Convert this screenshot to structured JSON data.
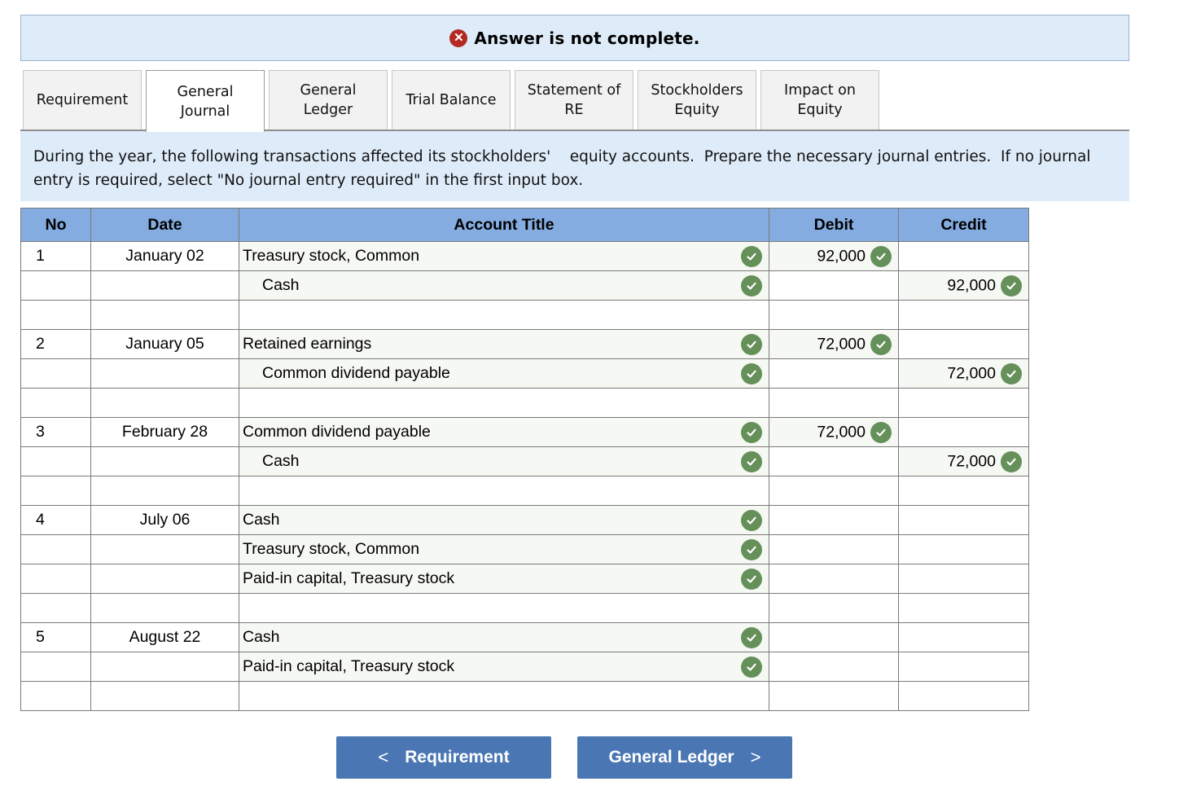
{
  "banner": {
    "icon": "error-x-icon",
    "text": "Answer is not complete."
  },
  "tabs": [
    {
      "label": "Requirement",
      "active": false
    },
    {
      "label": "General\nJournal",
      "active": true
    },
    {
      "label": "General\nLedger",
      "active": false
    },
    {
      "label": "Trial Balance",
      "active": false
    },
    {
      "label": "Statement of\nRE",
      "active": false
    },
    {
      "label": "Stockholders\nEquity",
      "active": false
    },
    {
      "label": "Impact on\nEquity",
      "active": false
    }
  ],
  "instructions": "During the year, the following transactions affected its stockholders'    equity accounts.  Prepare the necessary journal entries.  If no journal entry is required, select \"No journal entry required\" in the first input box.",
  "journal": {
    "headers": {
      "no": "No",
      "date": "Date",
      "account": "Account Title",
      "debit": "Debit",
      "credit": "Credit"
    },
    "rows": [
      {
        "no": "1",
        "date": "January 02",
        "account": "Treasury stock, Common",
        "indent": false,
        "acct_check": true,
        "debit": "92,000",
        "debit_check": true,
        "credit": "",
        "credit_check": false
      },
      {
        "no": "",
        "date": "",
        "account": "Cash",
        "indent": true,
        "acct_check": true,
        "debit": "",
        "debit_check": false,
        "credit": "92,000",
        "credit_check": true
      },
      {
        "no": "",
        "date": "",
        "account": "",
        "indent": false,
        "acct_check": false,
        "debit": "",
        "debit_check": false,
        "credit": "",
        "credit_check": false
      },
      {
        "no": "2",
        "date": "January 05",
        "account": "Retained earnings",
        "indent": false,
        "acct_check": true,
        "debit": "72,000",
        "debit_check": true,
        "credit": "",
        "credit_check": false
      },
      {
        "no": "",
        "date": "",
        "account": "Common dividend payable",
        "indent": true,
        "acct_check": true,
        "debit": "",
        "debit_check": false,
        "credit": "72,000",
        "credit_check": true
      },
      {
        "no": "",
        "date": "",
        "account": "",
        "indent": false,
        "acct_check": false,
        "debit": "",
        "debit_check": false,
        "credit": "",
        "credit_check": false
      },
      {
        "no": "3",
        "date": "February 28",
        "account": "Common dividend payable",
        "indent": false,
        "acct_check": true,
        "debit": "72,000",
        "debit_check": true,
        "credit": "",
        "credit_check": false
      },
      {
        "no": "",
        "date": "",
        "account": "Cash",
        "indent": true,
        "acct_check": true,
        "debit": "",
        "debit_check": false,
        "credit": "72,000",
        "credit_check": true
      },
      {
        "no": "",
        "date": "",
        "account": "",
        "indent": false,
        "acct_check": false,
        "debit": "",
        "debit_check": false,
        "credit": "",
        "credit_check": false
      },
      {
        "no": "4",
        "date": "July 06",
        "account": "Cash",
        "indent": false,
        "acct_check": true,
        "debit": "",
        "debit_check": false,
        "credit": "",
        "credit_check": false
      },
      {
        "no": "",
        "date": "",
        "account": "Treasury stock, Common",
        "indent": false,
        "acct_check": true,
        "debit": "",
        "debit_check": false,
        "credit": "",
        "credit_check": false
      },
      {
        "no": "",
        "date": "",
        "account": "Paid-in capital, Treasury stock",
        "indent": false,
        "acct_check": true,
        "debit": "",
        "debit_check": false,
        "credit": "",
        "credit_check": false
      },
      {
        "no": "",
        "date": "",
        "account": "",
        "indent": false,
        "acct_check": false,
        "debit": "",
        "debit_check": false,
        "credit": "",
        "credit_check": false
      },
      {
        "no": "5",
        "date": "August 22",
        "account": "Cash",
        "indent": false,
        "acct_check": true,
        "debit": "",
        "debit_check": false,
        "credit": "",
        "credit_check": false
      },
      {
        "no": "",
        "date": "",
        "account": "Paid-in capital, Treasury stock",
        "indent": false,
        "acct_check": true,
        "debit": "",
        "debit_check": false,
        "credit": "",
        "credit_check": false
      },
      {
        "no": "",
        "date": "",
        "account": "",
        "indent": false,
        "acct_check": false,
        "debit": "",
        "debit_check": false,
        "credit": "",
        "credit_check": false
      }
    ]
  },
  "nav": {
    "prev_label": "Requirement",
    "prev_icon": "chevron-left-icon",
    "next_label": "General Ledger",
    "next_icon": "chevron-right-icon"
  },
  "colors": {
    "banner_bg": "#deebf8",
    "error_icon": "#b32a22",
    "table_header": "#84ace0",
    "check_green": "#65905a",
    "nav_button": "#4a77b4"
  }
}
